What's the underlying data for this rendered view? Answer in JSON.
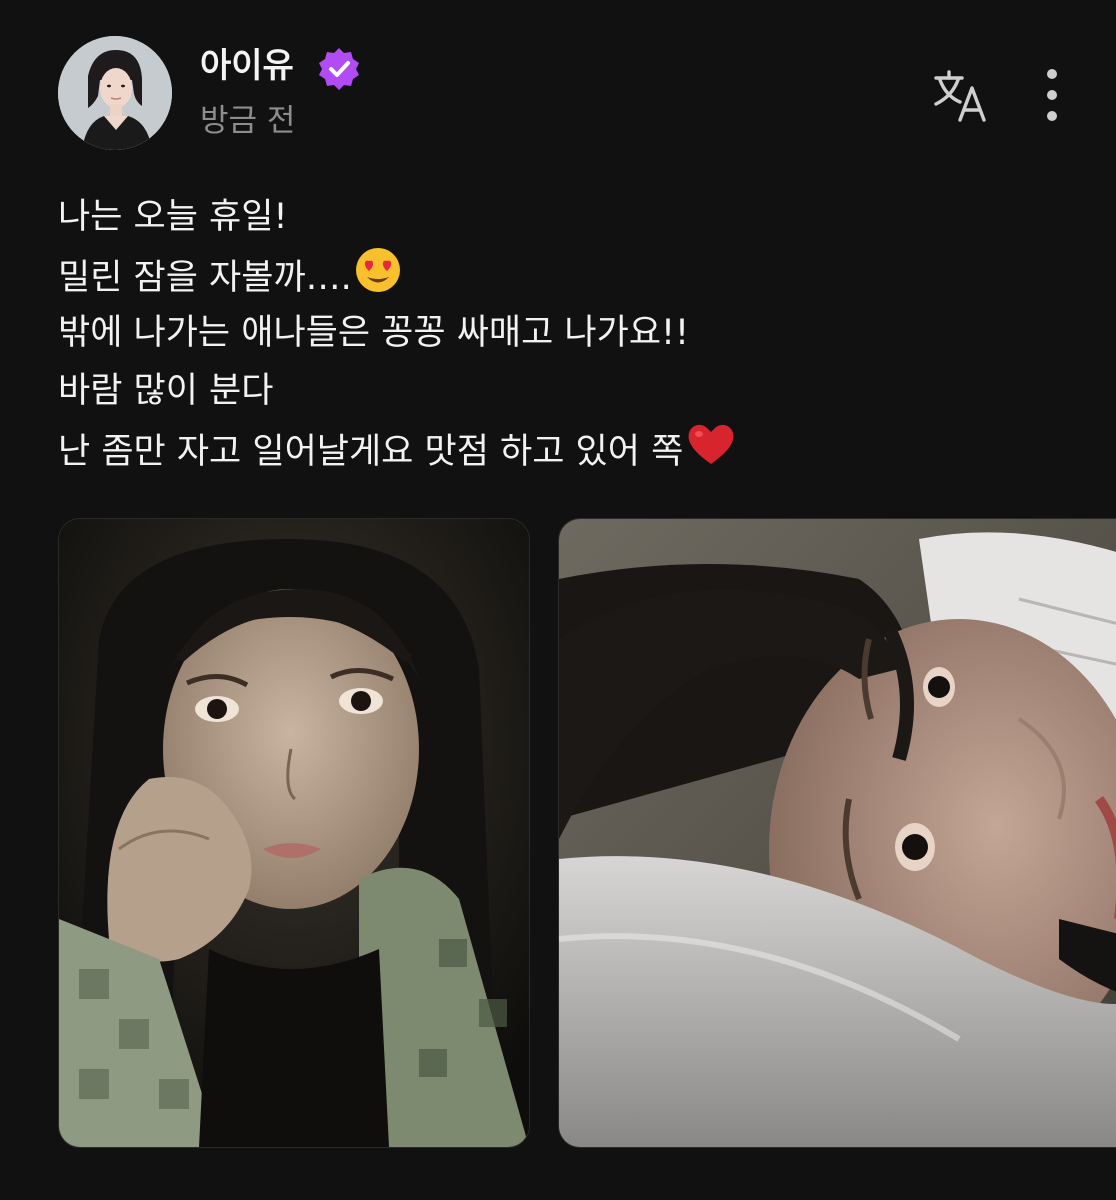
{
  "post": {
    "author": {
      "name": "아이유",
      "verified": true,
      "timestamp": "방금 전",
      "avatar": "profile-photo"
    },
    "actions": {
      "translate_icon": "translate-icon",
      "more_icon": "more-vertical-icon"
    },
    "lines": [
      "나는 오늘 휴일!",
      "밀린 잠을 자볼까….",
      "밖에 나가는 애나들은 꽁꽁 싸매고 나가요!!",
      "바람 많이 분다",
      "난 좀만 자고 일어날게요 맛점 하고 있어 쪽"
    ],
    "emojis": [
      "heart-eyes-emoji",
      "red-heart-emoji"
    ],
    "images": [
      "selfie-photo-1",
      "selfie-photo-2"
    ]
  },
  "colors": {
    "background": "#111111",
    "verified_badge": "#b14bf4",
    "timestamp": "#8d8d8d"
  }
}
